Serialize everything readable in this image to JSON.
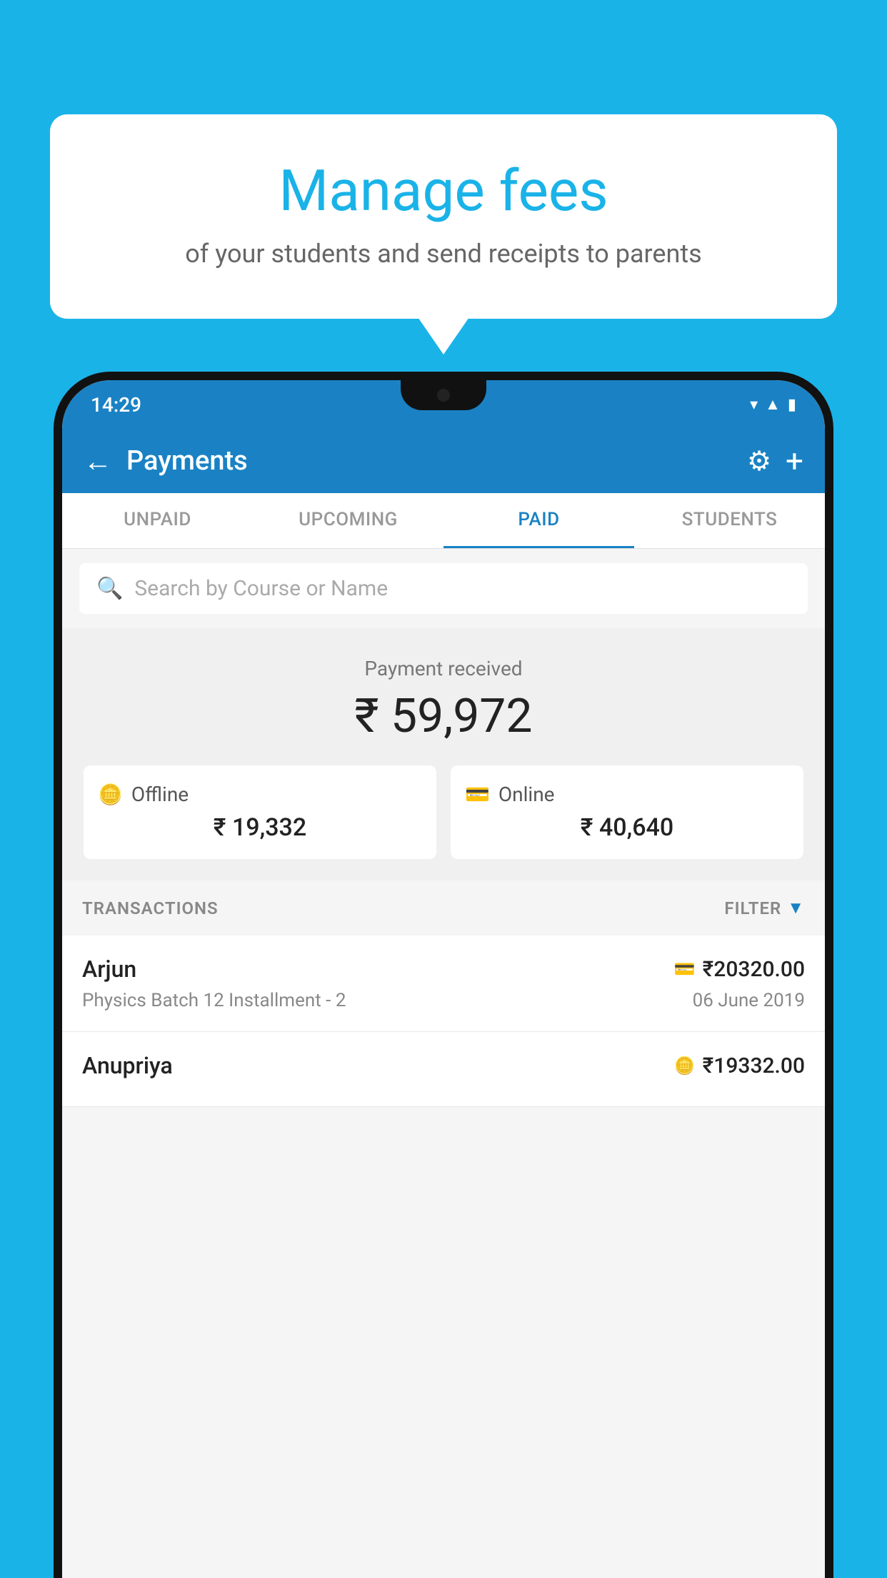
{
  "background_color": "#1ab3e8",
  "speech_bubble": {
    "title": "Manage fees",
    "subtitle": "of your students and send receipts to parents"
  },
  "status_bar": {
    "time": "14:29"
  },
  "top_bar": {
    "title": "Payments",
    "back_label": "←",
    "gear_label": "⚙",
    "plus_label": "+"
  },
  "tabs": [
    {
      "label": "UNPAID",
      "active": false
    },
    {
      "label": "UPCOMING",
      "active": false
    },
    {
      "label": "PAID",
      "active": true
    },
    {
      "label": "STUDENTS",
      "active": false
    }
  ],
  "search": {
    "placeholder": "Search by Course or Name"
  },
  "payment_received": {
    "label": "Payment received",
    "total": "₹ 59,972",
    "offline_label": "Offline",
    "offline_amount": "₹ 19,332",
    "online_label": "Online",
    "online_amount": "₹ 40,640"
  },
  "transactions": {
    "header_label": "TRANSACTIONS",
    "filter_label": "FILTER",
    "items": [
      {
        "name": "Arjun",
        "payment_icon": "card",
        "amount": "₹20320.00",
        "course": "Physics Batch 12 Installment - 2",
        "date": "06 June 2019"
      },
      {
        "name": "Anupriya",
        "payment_icon": "cash",
        "amount": "₹19332.00",
        "course": "",
        "date": ""
      }
    ]
  }
}
